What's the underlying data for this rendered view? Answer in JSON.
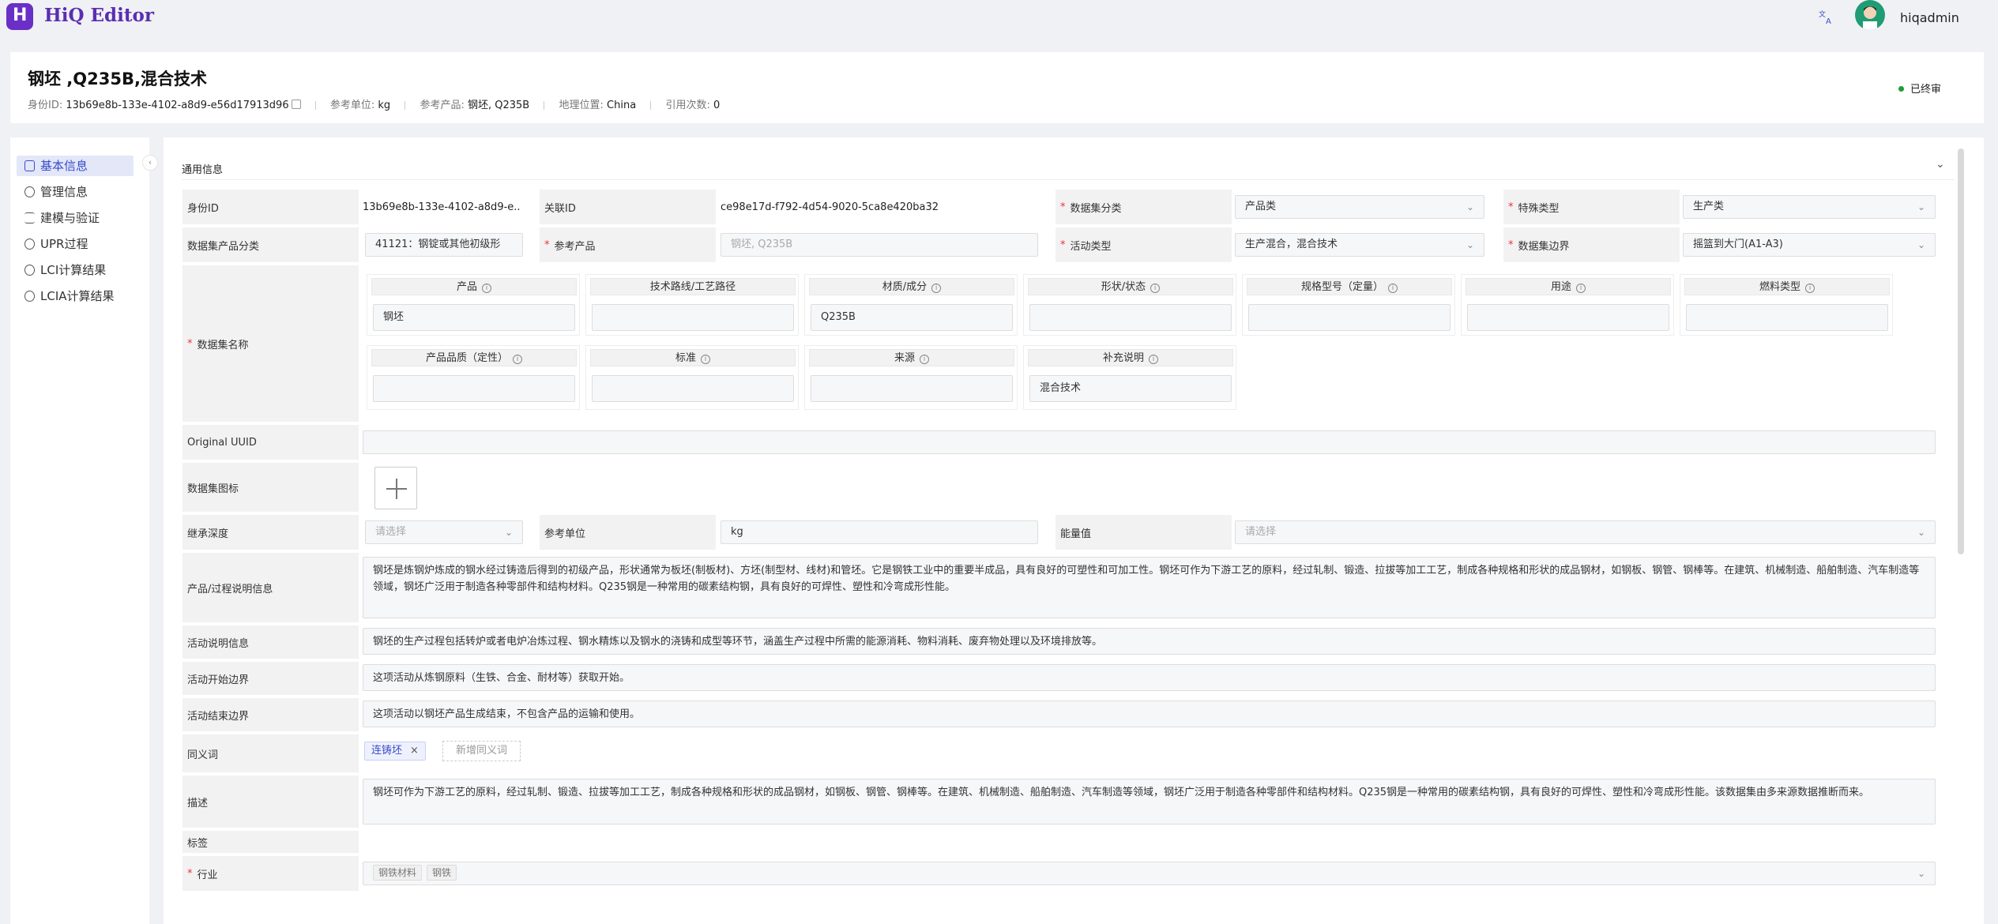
{
  "app": {
    "logo_letter": "H",
    "title": "HiQ Editor",
    "username": "hiqadmin"
  },
  "header": {
    "title": "钢坯 ,Q235B,混合技术",
    "id_label": "身份ID:",
    "id_value": "13b69e8b-133e-4102-a8d9-e56d17913d96",
    "ref_unit_label": "参考单位:",
    "ref_unit_value": "kg",
    "ref_product_label": "参考产品:",
    "ref_product_value": "钢坯, Q235B",
    "location_label": "地理位置:",
    "location_value": "China",
    "citations_label": "引用次数:",
    "citations_value": "0",
    "status": "已终审",
    "status_color": "#1b9e3a"
  },
  "sidebar": {
    "items": [
      {
        "label": "基本信息",
        "active": true
      },
      {
        "label": "管理信息"
      },
      {
        "label": "建模与验证"
      },
      {
        "label": "UPR过程"
      },
      {
        "label": "LCI计算结果"
      },
      {
        "label": "LCIA计算结果"
      }
    ],
    "collapse_glyph": "‹"
  },
  "section": {
    "title": "通用信息",
    "chevron": "⌄"
  },
  "form": {
    "identity_id_label": "身份ID",
    "identity_id_value": "13b69e8b-133e-4102-a8d9-e...",
    "link_id_label": "关联ID",
    "link_id_value": "ce98e17d-f792-4d54-9020-5ca8e420ba32",
    "dataset_category_label": "数据集分类",
    "dataset_category_value": "产品类",
    "special_type_label": "特殊类型",
    "special_type_value": "生产类",
    "product_category_label": "数据集产品分类",
    "product_category_value": "41121：钢锭或其他初级形",
    "ref_product_label": "参考产品",
    "ref_product_value": "钢坯, Q235B",
    "activity_type_label": "活动类型",
    "activity_type_value": "生产混合，混合技术",
    "boundary_label": "数据集边界",
    "boundary_value": "摇篮到大门(A1-A3)",
    "dataset_name_label": "数据集名称",
    "name_fields": [
      {
        "label": "产品",
        "value": "钢坯"
      },
      {
        "label": "技术路线/工艺路径",
        "value": ""
      },
      {
        "label": "材质/成分",
        "value": "Q235B"
      },
      {
        "label": "形状/状态",
        "value": ""
      },
      {
        "label": "规格型号（定量）",
        "value": ""
      },
      {
        "label": "用途",
        "value": ""
      },
      {
        "label": "燃料类型",
        "value": ""
      },
      {
        "label": "产品品质（定性）",
        "value": ""
      },
      {
        "label": "标准",
        "value": ""
      },
      {
        "label": "来源",
        "value": ""
      },
      {
        "label": "补充说明",
        "value": "混合技术"
      }
    ],
    "original_uuid_label": "Original UUID",
    "original_uuid_value": "",
    "icon_label": "数据集图标",
    "inherit_depth_label": "继承深度",
    "inherit_depth_placeholder": "请选择",
    "ref_unit_label": "参考单位",
    "ref_unit_value": "kg",
    "energy_label": "能量值",
    "energy_placeholder": "请选择",
    "process_desc_label": "产品/过程说明信息",
    "process_desc_value": "钢坯是炼钢炉炼成的钢水经过铸造后得到的初级产品，形状通常为板坯(制板材)、方坯(制型材、线材)和管坯。它是钢铁工业中的重要半成品，具有良好的可塑性和可加工性。钢坯可作为下游工艺的原料，经过轧制、锻造、拉拔等加工工艺，制成各种规格和形状的成品钢材，如钢板、钢管、钢棒等。在建筑、机械制造、船舶制造、汽车制造等领域，钢坯广泛用于制造各种零部件和结构材料。Q235钢是一种常用的碳素结构钢，具有良好的可焊性、塑性和冷弯成形性能。",
    "activity_desc_label": "活动说明信息",
    "activity_desc_value": "钢坯的生产过程包括转炉或者电炉冶炼过程、钢水精炼以及钢水的浇铸和成型等环节，涵盖生产过程中所需的能源消耗、物料消耗、废弃物处理以及环境排放等。",
    "activity_start_label": "活动开始边界",
    "activity_start_value": "这项活动从炼钢原料（生铁、合金、耐材等）获取开始。",
    "activity_end_label": "活动结束边界",
    "activity_end_value": "这项活动以钢坯产品生成结束，不包含产品的运输和使用。",
    "synonym_label": "同义词",
    "synonym_tag": "连铸坯",
    "synonym_close": "×",
    "synonym_add": "新增同义词",
    "description_label": "描述",
    "description_value": "钢坯可作为下游工艺的原料，经过轧制、锻造、拉拔等加工工艺，制成各种规格和形状的成品钢材，如钢板、钢管、钢棒等。在建筑、机械制造、船舶制造、汽车制造等领域，钢坯广泛用于制造各种零部件和结构材料。Q235钢是一种常用的碳素结构钢，具有良好的可焊性、塑性和冷弯成形性能。该数据集由多来源数据推断而来。",
    "tag_label": "标签",
    "industry_label": "行业",
    "industry_chips": [
      "钢铁材料",
      "钢铁"
    ]
  }
}
